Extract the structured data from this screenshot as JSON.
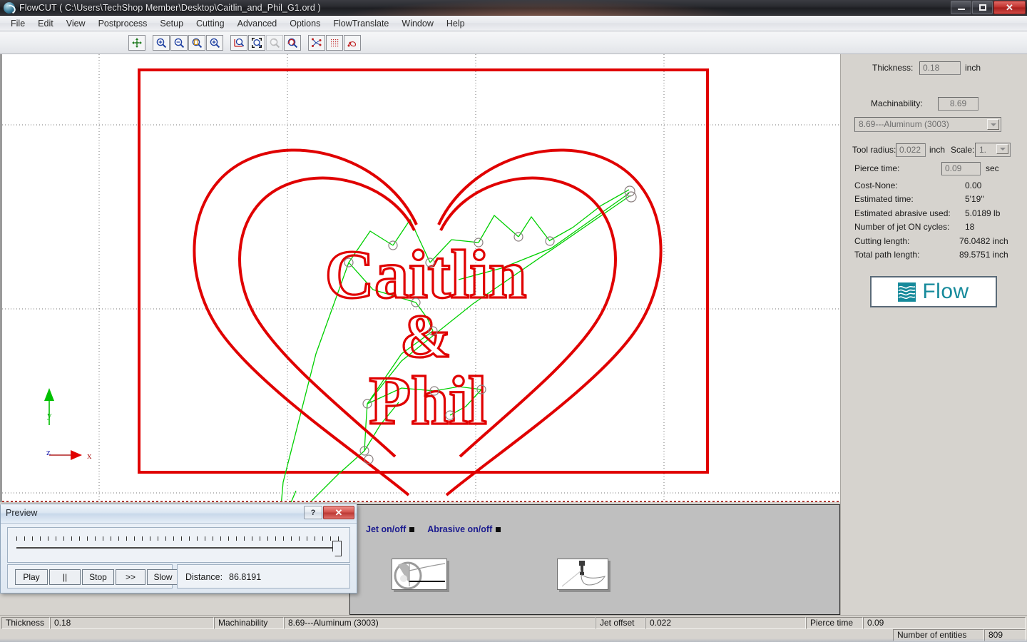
{
  "window": {
    "app_name": "FlowCUT",
    "title": "FlowCUT ( C:\\Users\\TechShop Member\\Desktop\\Caitlin_and_Phil_G1.ord )",
    "minimize_label": "",
    "maximize_label": "",
    "close_label": "✕"
  },
  "menubar": {
    "items": [
      {
        "label": "File"
      },
      {
        "label": "Edit"
      },
      {
        "label": "View"
      },
      {
        "label": "Postprocess"
      },
      {
        "label": "Setup"
      },
      {
        "label": "Cutting"
      },
      {
        "label": "Advanced"
      },
      {
        "label": "Options"
      },
      {
        "label": "FlowTranslate"
      },
      {
        "label": "Window"
      },
      {
        "label": "Help"
      }
    ]
  },
  "toolbar": {
    "buttons": [
      {
        "name": "pan-icon"
      },
      {
        "name": "zoom-in-icon"
      },
      {
        "name": "zoom-out-icon"
      },
      {
        "name": "zoom-window-icon"
      },
      {
        "name": "zoom-dynamic-icon"
      },
      {
        "name": "zoom-extents-icon"
      },
      {
        "name": "zoom-fit-icon"
      },
      {
        "name": "zoom-previous-icon"
      },
      {
        "name": "zoom-redo-icon"
      },
      {
        "name": "show-path-icon"
      },
      {
        "name": "show-grid-icon"
      },
      {
        "name": "show-leads-icon"
      }
    ]
  },
  "drawing": {
    "design_text_line1": "Caitlin",
    "design_text_line2": "&",
    "design_text_line3": "Phil",
    "axis_x_label": "x",
    "axis_y_label": "y",
    "axis_z_label": "z",
    "cut_color": "#e00000",
    "traverse_color": "#00d000"
  },
  "right_panel": {
    "thickness_label": "Thickness:",
    "thickness_value": "0.18",
    "thickness_unit": "inch",
    "machinability_label": "Machinability:",
    "machinability_value": "8.69",
    "material_selected": "8.69---Aluminum (3003)",
    "tool_radius_label": "Tool radius:",
    "tool_radius_value": "0.022",
    "tool_radius_unit": "inch",
    "scale_label": "Scale:",
    "scale_value": "1.",
    "pierce_time_label": "Pierce time:",
    "pierce_time_value": "0.09",
    "pierce_time_unit": "sec",
    "stats": [
      {
        "label": "Cost-None:",
        "value": "0.00"
      },
      {
        "label": "Estimated time:",
        "value": "5'19\""
      },
      {
        "label": "Estimated abrasive used:",
        "value": "5.0189 lb"
      },
      {
        "label": "Number of jet ON cycles:",
        "value": "18"
      },
      {
        "label": "Cutting length:",
        "value": "76.0482 inch"
      },
      {
        "label": "Total path length:",
        "value": "89.5751 inch"
      }
    ],
    "logo_text": "Flow",
    "logo_color": "#168a9b"
  },
  "bottom_panel": {
    "jet_label": "Jet on/off",
    "abrasive_label": "Abrasive on/off",
    "pic1_name": "nozzle-diagram-image",
    "pic2_name": "jet-stream-diagram-image"
  },
  "preview": {
    "title": "Preview",
    "help_label": "?",
    "close_label": "✕",
    "buttons": [
      {
        "label": "Play"
      },
      {
        "label": "||"
      },
      {
        "label": "Stop"
      },
      {
        "label": ">>"
      },
      {
        "label": "Slow"
      }
    ],
    "distance_label": "Distance:",
    "distance_value": "86.8191",
    "slider_position_percent": 100
  },
  "statusbar": {
    "row1": [
      {
        "label": "Thickness",
        "value": "0.18"
      },
      {
        "label": "Machinability",
        "value": "8.69---Aluminum (3003)"
      },
      {
        "label": "Jet offset",
        "value": "0.022"
      },
      {
        "label": "Pierce time",
        "value": "0.09"
      }
    ],
    "row2": [
      {
        "label": "Number of entities",
        "value": "809"
      }
    ]
  }
}
